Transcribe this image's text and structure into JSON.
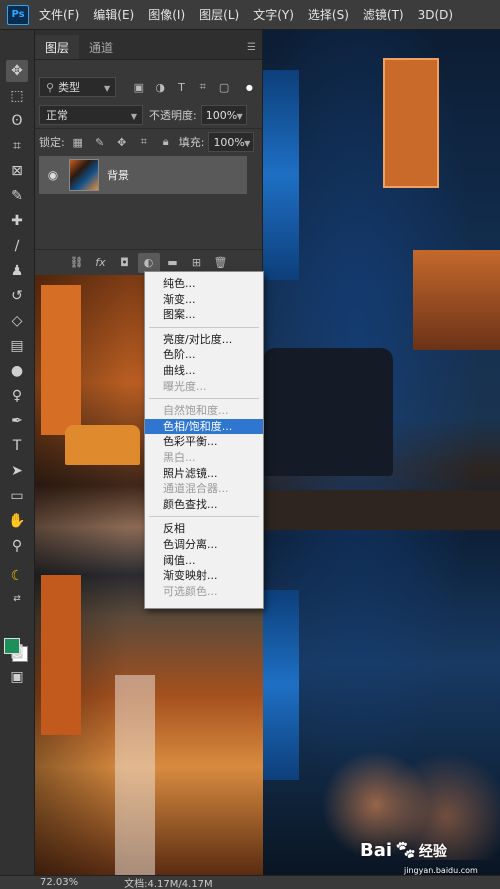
{
  "app": {
    "logo": "Ps"
  },
  "menubar": {
    "items": [
      "文件(F)",
      "编辑(E)",
      "图像(I)",
      "图层(L)",
      "文字(Y)",
      "选择(S)",
      "滤镜(T)",
      "3D(D)"
    ]
  },
  "layers_panel": {
    "tabs": [
      "图层",
      "通道"
    ],
    "filter_kind": "类型",
    "blend_mode": "正常",
    "opacity_label": "不透明度:",
    "opacity_value": "100%",
    "lock_label": "锁定:",
    "fill_label": "填充:",
    "fill_value": "100%",
    "layer_name": "背景"
  },
  "adjust_menu": {
    "group1": [
      "纯色...",
      "渐变...",
      "图案..."
    ],
    "group2": [
      "亮度/对比度...",
      "色阶...",
      "曲线...",
      "曝光度..."
    ],
    "group3": [
      "自然饱和度...",
      "色相/饱和度...",
      "色彩平衡...",
      "黑白...",
      "照片滤镜...",
      "通道混合器...",
      "颜色查找..."
    ],
    "group4": [
      "反相",
      "色调分离...",
      "阈值...",
      "渐变映射...",
      "可选颜色..."
    ],
    "selected": "色相/饱和度...",
    "disabled": [
      "曝光度...",
      "自然饱和度...",
      "黑白...",
      "通道混合器...",
      "可选颜色..."
    ]
  },
  "statusbar": {
    "zoom": "72.03%",
    "doc": "文档:4.17M/4.17M"
  },
  "watermark": {
    "brand": "Bai",
    "brand_cn": "经验",
    "url": "jingyan.baidu.com"
  },
  "colors": {
    "foreground": "#1d8f5a",
    "background": "#ffffff",
    "selection": "#2f76d1"
  }
}
